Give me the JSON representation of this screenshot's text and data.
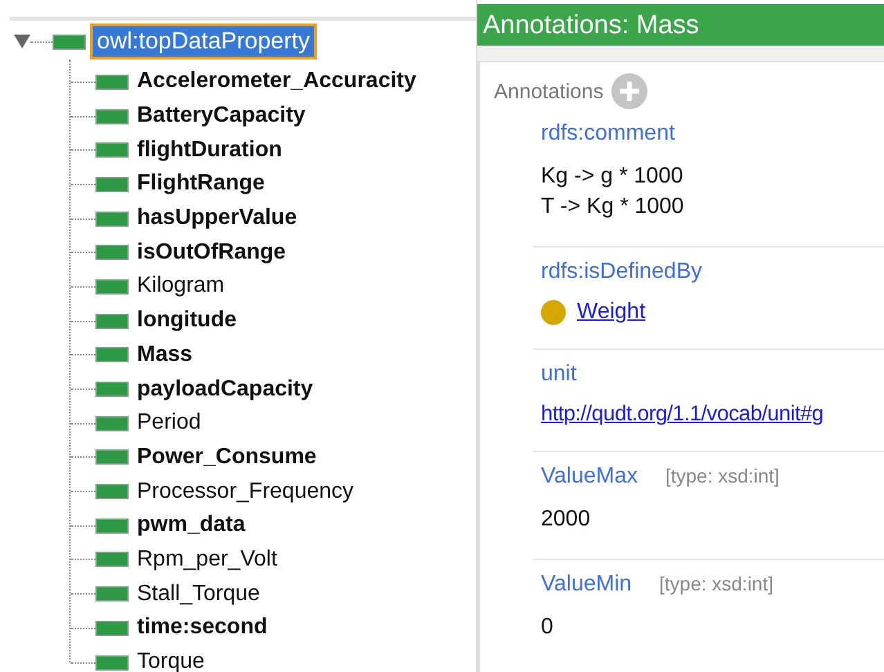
{
  "tree": {
    "root": {
      "label": "owl:topDataProperty",
      "selected": true,
      "expanded": true,
      "children": [
        {
          "label": "Accelerometer_Accuracity",
          "bold": true,
          "selected": false
        },
        {
          "label": "BatteryCapacity",
          "bold": true,
          "selected": false
        },
        {
          "label": "flightDuration",
          "bold": true,
          "selected": false
        },
        {
          "label": "FlightRange",
          "bold": true,
          "selected": false
        },
        {
          "label": "hasUpperValue",
          "bold": true,
          "selected": false
        },
        {
          "label": "isOutOfRange",
          "bold": true,
          "selected": false
        },
        {
          "label": "Kilogram",
          "bold": false,
          "selected": false
        },
        {
          "label": "longitude",
          "bold": true,
          "selected": false
        },
        {
          "label": "Mass",
          "bold": true,
          "selected": false
        },
        {
          "label": "payloadCapacity",
          "bold": true,
          "selected": false
        },
        {
          "label": "Period",
          "bold": false,
          "selected": false
        },
        {
          "label": "Power_Consume",
          "bold": true,
          "selected": false
        },
        {
          "label": "Processor_Frequency",
          "bold": false,
          "selected": false
        },
        {
          "label": "pwm_data",
          "bold": true,
          "selected": false
        },
        {
          "label": "Rpm_per_Volt",
          "bold": false,
          "selected": false
        },
        {
          "label": "Stall_Torque",
          "bold": false,
          "selected": false
        },
        {
          "label": "time:second",
          "bold": true,
          "selected": false
        },
        {
          "label": "Torque",
          "bold": false,
          "selected": false
        }
      ]
    }
  },
  "annotations": {
    "title": "Annotations: Mass",
    "section_label": "Annotations",
    "entries": [
      {
        "property": "rdfs:comment",
        "kind": "text",
        "lines": [
          "Kg -> g * 1000",
          "T -> Kg * 1000"
        ]
      },
      {
        "property": "rdfs:isDefinedBy",
        "kind": "entity",
        "value": "Weight",
        "color": "#d4a800"
      },
      {
        "property": "unit",
        "kind": "link",
        "value": "http://qudt.org/1.1/vocab/unit#g"
      },
      {
        "property": "ValueMax",
        "kind": "typed",
        "type": "[type: xsd:int]",
        "value": "2000"
      },
      {
        "property": "ValueMin",
        "kind": "typed",
        "type": "[type: xsd:int]",
        "value": "0"
      }
    ]
  }
}
